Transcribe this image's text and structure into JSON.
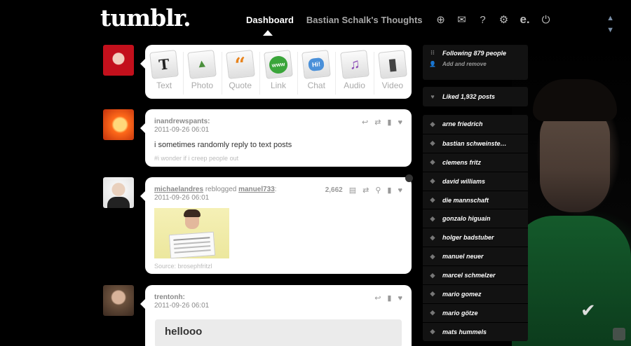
{
  "header": {
    "logo": "tumblr.",
    "nav_active": "Dashboard",
    "nav_blog": "Bastian Schalk's Thoughts",
    "icons": [
      "plus-icon",
      "mail-icon",
      "help-icon",
      "gear-icon",
      "e-icon",
      "power-icon"
    ]
  },
  "composer": {
    "types": [
      {
        "label": "Text",
        "glyph": "T",
        "color": "#222"
      },
      {
        "label": "Photo",
        "glyph": "▲",
        "color": "#4a8f3c"
      },
      {
        "label": "Quote",
        "glyph": "“",
        "color": "#e8821a"
      },
      {
        "label": "Link",
        "glyph": "www",
        "color": "#3aa53a"
      },
      {
        "label": "Chat",
        "glyph": "Hi!",
        "color": "#4a90d9"
      },
      {
        "label": "Audio",
        "glyph": "♫",
        "color": "#8a4ab5"
      },
      {
        "label": "Video",
        "glyph": "▮",
        "color": "#444"
      }
    ]
  },
  "posts": [
    {
      "user": "inandrewspants:",
      "date": "2011-09-26 06:01",
      "body": "i sometimes randomly reply to text posts",
      "tags": "#i wonder if i creep people out"
    },
    {
      "user": "michaelandres",
      "action": "reblogged",
      "from": "manuel733",
      "colon": ":",
      "date": "2011-09-26 06:01",
      "notes": "2,662",
      "source": "Source: brosephfritzl"
    },
    {
      "user": "trentonh:",
      "date": "2011-09-26 06:01",
      "chat": "hellooo"
    }
  ],
  "sidebar": {
    "following": "Following 879 people",
    "add_remove": "Add and remove",
    "liked": "Liked 1,932 posts",
    "tags": [
      "arne friedrich",
      "bastian schweinste…",
      "clemens fritz",
      "david williams",
      "die mannschaft",
      "gonzalo higuain",
      "holger badstuber",
      "manuel neuer",
      "marcel schmelzer",
      "mario gomez",
      "mario götze",
      "mats hummels"
    ]
  }
}
